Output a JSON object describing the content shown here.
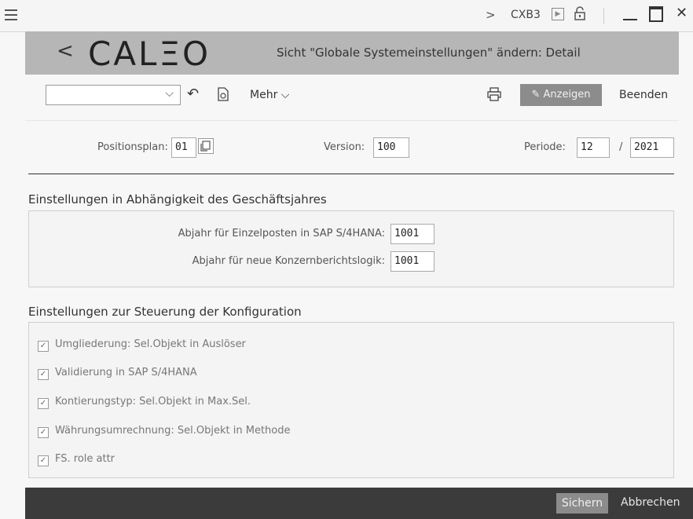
{
  "titlebar": {
    "transaction_code": "CXB3"
  },
  "header": {
    "logo_text": "CALΞO",
    "title": "Sicht \"Globale Systemeinstellungen\" ändern: Detail"
  },
  "toolbar": {
    "combo_value": "",
    "more_label": "Mehr",
    "display_label": "Anzeigen",
    "exit_label": "Beenden"
  },
  "keys": {
    "positionsplan_label": "Positionsplan:",
    "positionsplan_value": "01",
    "version_label": "Version:",
    "version_value": "100",
    "periode_label": "Periode:",
    "periode_value": "12",
    "periode_sep": "/",
    "year_value": "2021"
  },
  "section_fiscal_year": {
    "title": "Einstellungen in Abhängigkeit des Geschäftsjahres",
    "fields": [
      {
        "label": "Abjahr für Einzelposten in SAP S/4HANA:",
        "value": "1001"
      },
      {
        "label": "Abjahr für neue Konzernberichtslogik:",
        "value": "1001"
      }
    ]
  },
  "section_config": {
    "title": "Einstellungen zur Steuerung der Konfiguration",
    "checkboxes": [
      {
        "label": "Umgliederung: Sel.Objekt in Auslöser",
        "checked": true
      },
      {
        "label": "Validierung in SAP S/4HANA",
        "checked": true
      },
      {
        "label": "Kontierungstyp: Sel.Objekt in Max.Sel.",
        "checked": true
      },
      {
        "label": "Währungsumrechnung: Sel.Objekt in Methode",
        "checked": true
      },
      {
        "label": "FS. role attr",
        "checked": true
      }
    ]
  },
  "footer": {
    "save_label": "Sichern",
    "cancel_label": "Abbrechen"
  },
  "colors": {
    "header_band": "#b6b6b6",
    "footer_bar": "#3b3b3b",
    "emphasized_button": "#8c8c8c"
  }
}
